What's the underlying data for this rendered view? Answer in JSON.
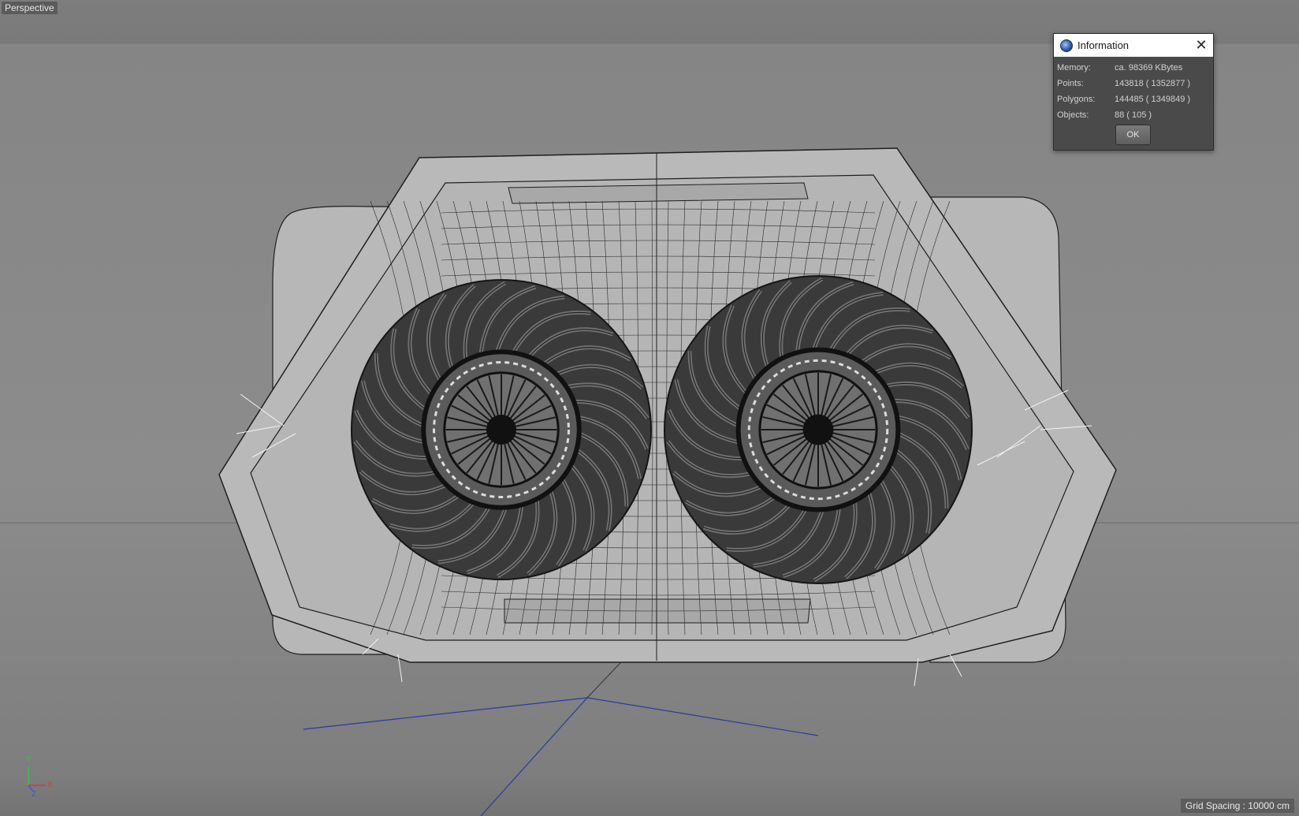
{
  "viewport": {
    "label": "Perspective",
    "grid_spacing": "Grid Spacing : 10000 cm",
    "axis_labels": {
      "y": "Y",
      "x": "X",
      "z": "Z"
    }
  },
  "dialog": {
    "title": "Information",
    "rows": [
      {
        "label": "Memory:",
        "value": "ca. 98369 KBytes"
      },
      {
        "label": "Points:",
        "value": "143818 ( 1352877 )"
      },
      {
        "label": "Polygons:",
        "value": "144485 ( 1349849 )"
      },
      {
        "label": "Objects:",
        "value": "88 ( 105 )"
      }
    ],
    "ok_label": "OK"
  },
  "colors": {
    "titlebar_bg": "#ffffff",
    "dialog_bg": "#4a4a4a",
    "mesh_fill": "#b9b9b9",
    "wire": "#1e1e1e",
    "axis_y": "#3bbf4a",
    "axis_x": "#d83a3a",
    "axis_z": "#3a5cd8"
  }
}
